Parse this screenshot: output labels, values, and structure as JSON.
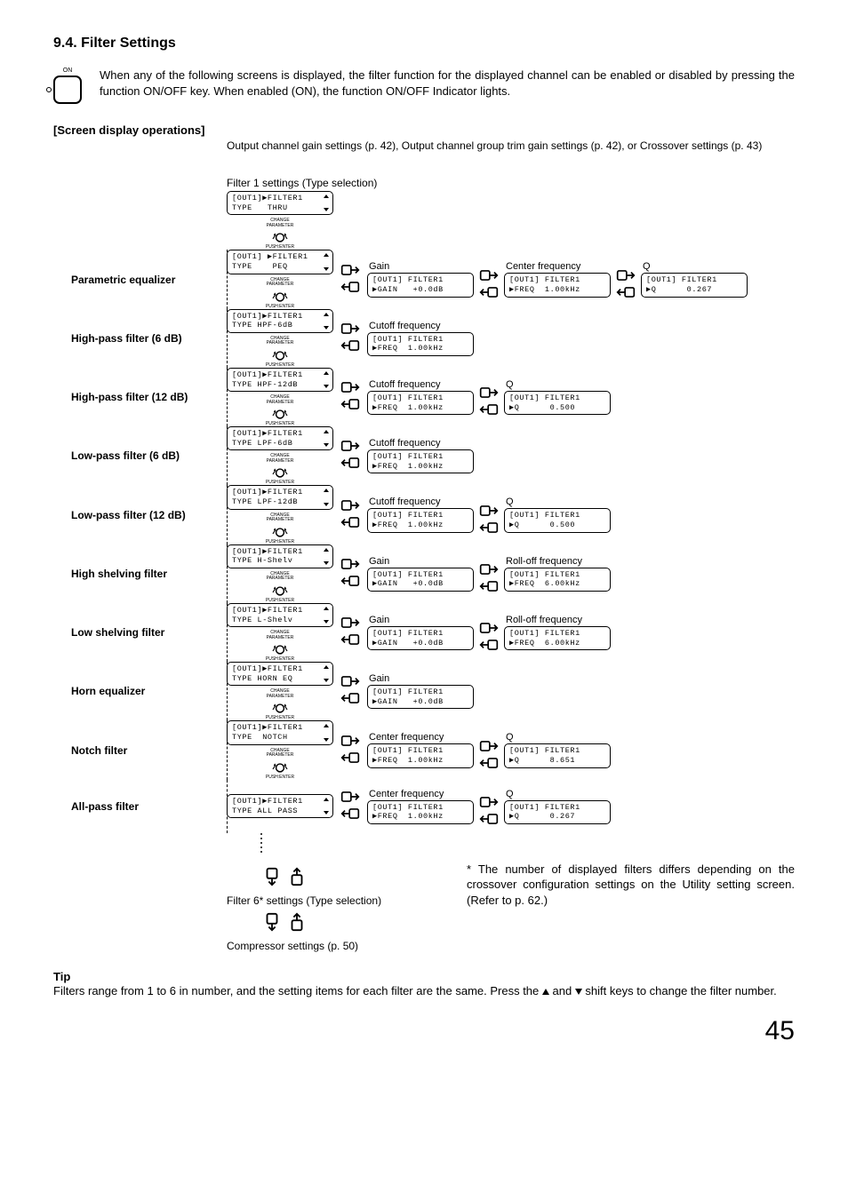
{
  "heading": "9.4. Filter Settings",
  "onoff": {
    "label": "ON"
  },
  "intro": "When any of the following screens is displayed, the filter function for the displayed channel can be enabled or disabled by pressing the function ON/OFF key. When enabled (ON), the function ON/OFF Indicator lights.",
  "subhead": "[Screen display operations]",
  "top_note": "Output channel gain settings (p. 42), Output channel group trim gain settings (p. 42), or Crossover settings (p. 43)",
  "filter1_label": "Filter 1 settings (Type selection)",
  "thru_screen": {
    "l1": "[OUT1]▶FILTER1",
    "l2": "TYPE   THRU"
  },
  "knob": {
    "lbl1": "CHANGE",
    "lbl2": "PARAMETER",
    "push": "PUSH:ENTER"
  },
  "rows": [
    {
      "label": "Parametric equalizer",
      "type": {
        "l1": "[OUT1] ▶FILTER1",
        "l2": "TYPE    PEQ"
      },
      "params": [
        {
          "title": "Gain",
          "l1": "[OUT1] FILTER1",
          "l2": "▶GAIN   +0.0dB"
        },
        {
          "title": "Center frequency",
          "l1": "[OUT1] FILTER1",
          "l2": "▶FREQ  1.00kHz"
        },
        {
          "title": "Q",
          "l1": "[OUT1] FILTER1",
          "l2": "▶Q      0.267"
        }
      ]
    },
    {
      "label": "High-pass filter (6 dB)",
      "type": {
        "l1": "[OUT1]▶FILTER1",
        "l2": "TYPE HPF-6dB"
      },
      "params": [
        {
          "title": "Cutoff frequency",
          "l1": "[OUT1] FILTER1",
          "l2": "▶FREQ  1.00kHz"
        }
      ]
    },
    {
      "label": "High-pass filter (12 dB)",
      "type": {
        "l1": "[OUT1]▶FILTER1",
        "l2": "TYPE HPF-12dB"
      },
      "params": [
        {
          "title": "Cutoff frequency",
          "l1": "[OUT1] FILTER1",
          "l2": "▶FREQ  1.00kHz"
        },
        {
          "title": "Q",
          "l1": "[OUT1] FILTER1",
          "l2": "▶Q      0.500"
        }
      ]
    },
    {
      "label": "Low-pass filter (6 dB)",
      "type": {
        "l1": "[OUT1]▶FILTER1",
        "l2": "TYPE LPF-6dB"
      },
      "params": [
        {
          "title": "Cutoff frequency",
          "l1": "[OUT1] FILTER1",
          "l2": "▶FREQ  1.00kHz"
        }
      ]
    },
    {
      "label": "Low-pass filter (12 dB)",
      "type": {
        "l1": "[OUT1]▶FILTER1",
        "l2": "TYPE LPF-12dB"
      },
      "params": [
        {
          "title": "Cutoff frequency",
          "l1": "[OUT1] FILTER1",
          "l2": "▶FREQ  1.00kHz"
        },
        {
          "title": "Q",
          "l1": "[OUT1] FILTER1",
          "l2": "▶Q      0.500"
        }
      ]
    },
    {
      "label": "High shelving filter",
      "type": {
        "l1": "[OUT1]▶FILTER1",
        "l2": "TYPE H-Shelv"
      },
      "params": [
        {
          "title": "Gain",
          "l1": "[OUT1] FILTER1",
          "l2": "▶GAIN   +0.0dB"
        },
        {
          "title": "Roll-off frequency",
          "l1": "[OUT1] FILTER1",
          "l2": "▶FREQ  6.00kHz"
        }
      ]
    },
    {
      "label": "Low shelving filter",
      "type": {
        "l1": "[OUT1]▶FILTER1",
        "l2": "TYPE L-Shelv"
      },
      "params": [
        {
          "title": "Gain",
          "l1": "[OUT1] FILTER1",
          "l2": "▶GAIN   +0.0dB"
        },
        {
          "title": "Roll-off frequency",
          "l1": "[OUT1] FILTER1",
          "l2": "▶FREQ  6.00kHz"
        }
      ]
    },
    {
      "label": "Horn equalizer",
      "type": {
        "l1": "[OUT1]▶FILTER1",
        "l2": "TYPE HORN EQ"
      },
      "params": [
        {
          "title": "Gain",
          "l1": "[OUT1] FILTER1",
          "l2": "▶GAIN   +0.0dB"
        }
      ]
    },
    {
      "label": "Notch filter",
      "type": {
        "l1": "[OUT1]▶FILTER1",
        "l2": "TYPE  NOTCH"
      },
      "params": [
        {
          "title": "Center frequency",
          "l1": "[OUT1] FILTER1",
          "l2": "▶FREQ  1.00kHz"
        },
        {
          "title": "Q",
          "l1": "[OUT1] FILTER1",
          "l2": "▶Q      8.651"
        }
      ]
    },
    {
      "label": "All-pass filter",
      "type": {
        "l1": "[OUT1]▶FILTER1",
        "l2": "TYPE ALL PASS"
      },
      "params": [
        {
          "title": "Center frequency",
          "l1": "[OUT1] FILTER1",
          "l2": "▶FREQ  1.00kHz"
        },
        {
          "title": "Q",
          "l1": "[OUT1] FILTER1",
          "l2": "▶Q      0.267"
        }
      ]
    }
  ],
  "filter6_label": "Filter 6* settings (Type selection)",
  "compressor_label": "Compressor settings (p. 50)",
  "footnote": "* The number of displayed filters differs depending on the crossover configuration settings on the Utility setting screen. (Refer to p. 62.)",
  "tip_head": "Tip",
  "tip_body_a": "Filters range from 1 to 6 in number, and the setting items for each filter are the same. Press the ",
  "tip_body_b": " and ",
  "tip_body_c": " shift keys to change the filter number.",
  "page": "45"
}
